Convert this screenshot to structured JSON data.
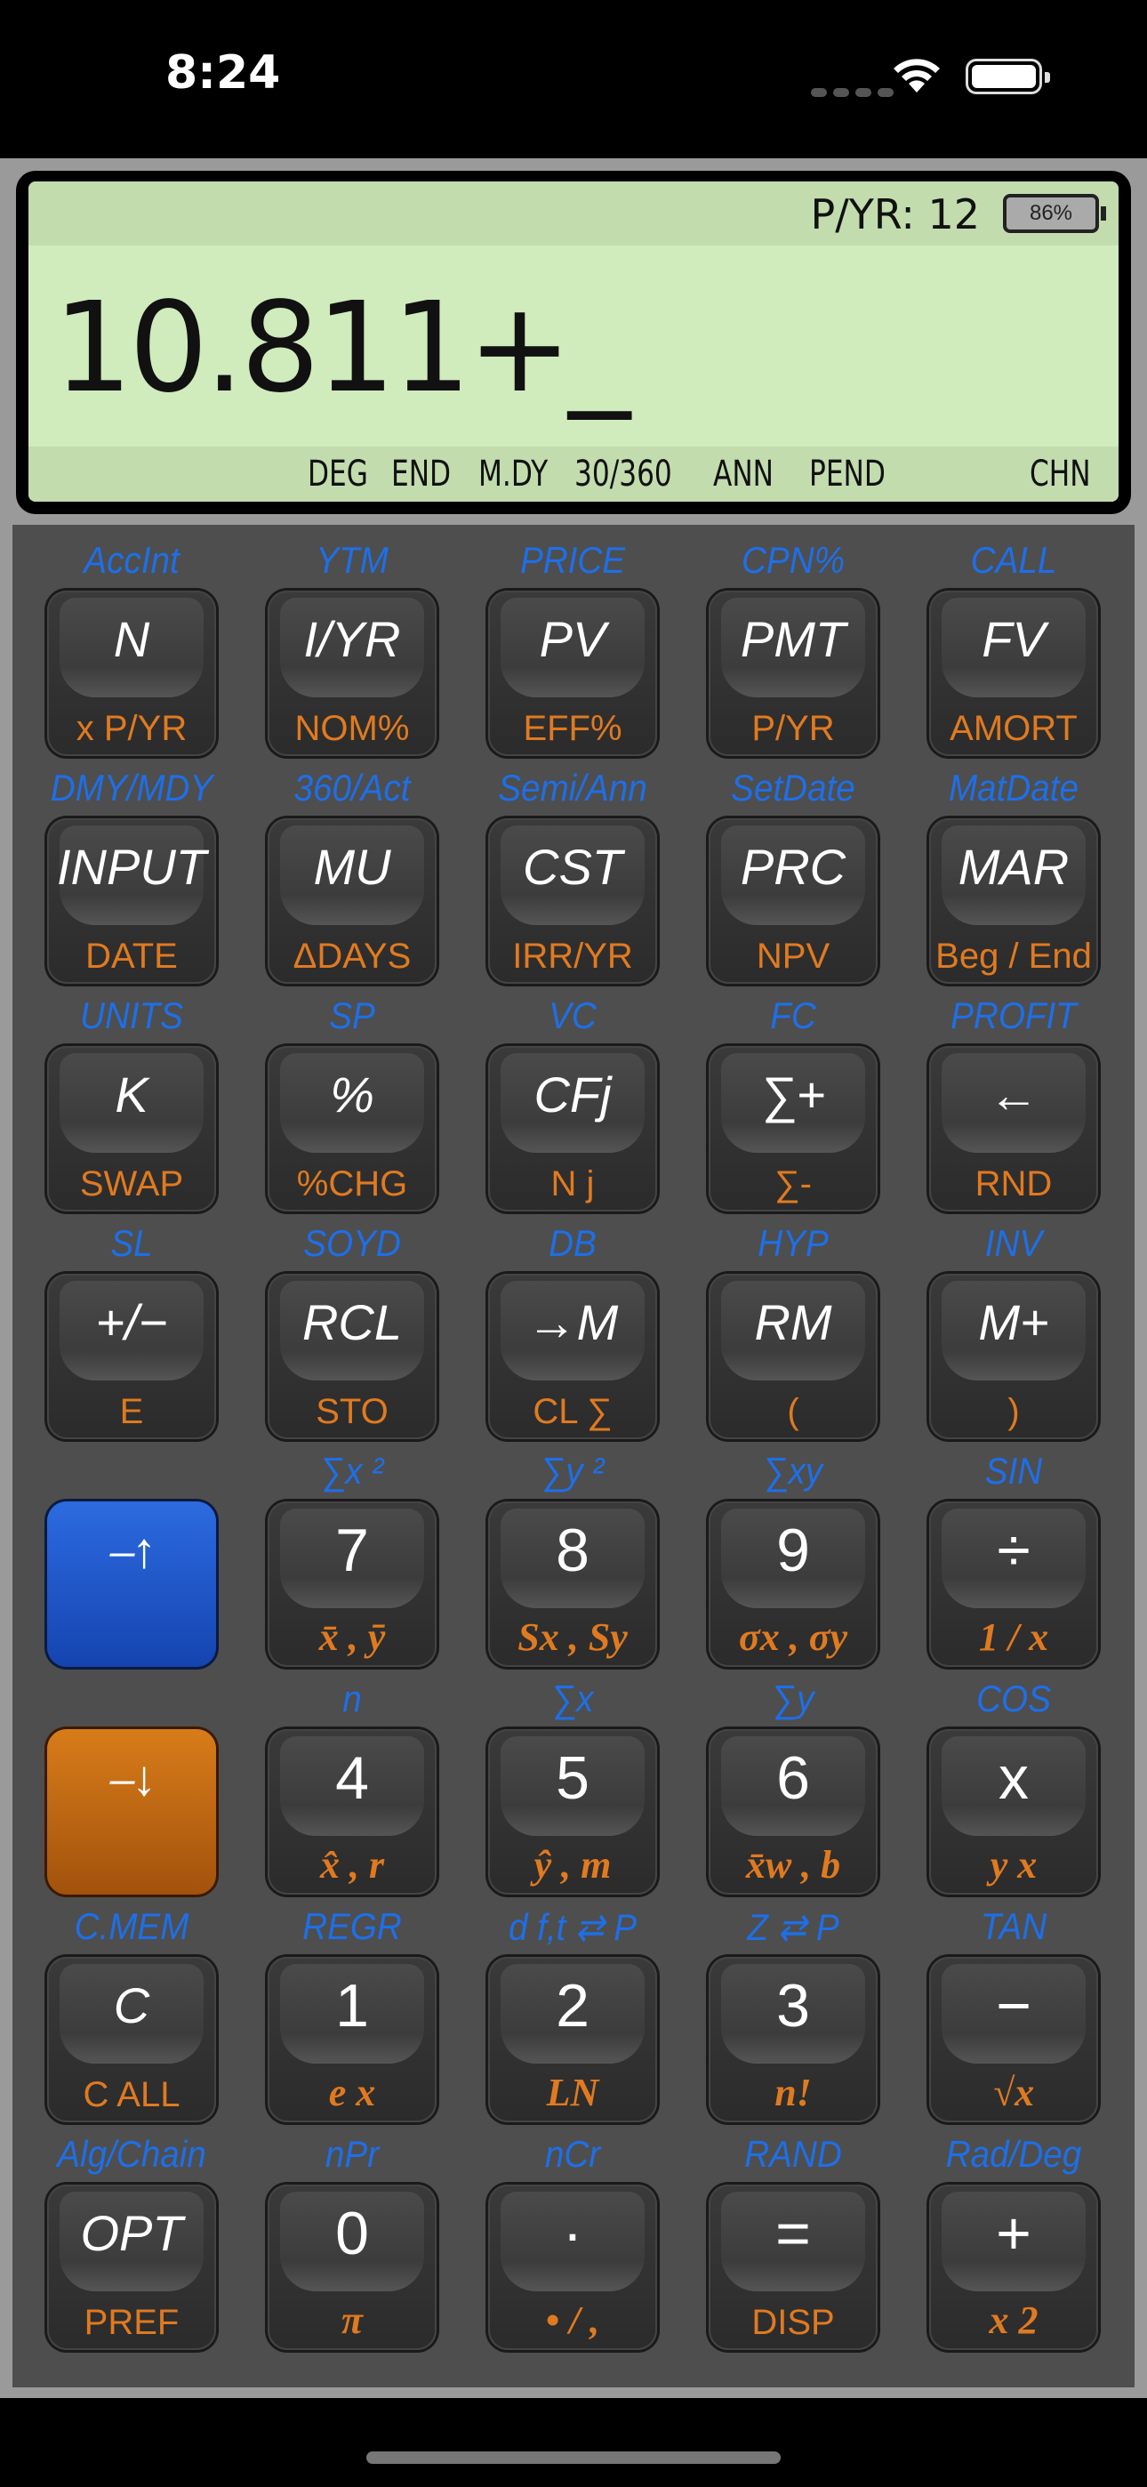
{
  "status_bar": {
    "time": "8:24"
  },
  "display": {
    "pyr": "P/YR: 12",
    "battery_pct": "86%",
    "readout": "10.811+_",
    "annunciators": [
      "DEG",
      "END",
      "M.DY",
      "30/360",
      "ANN",
      "PEND",
      "CHN"
    ]
  },
  "rows": [
    {
      "keys": [
        {
          "shift": "AccInt",
          "main": "N",
          "sub": "x P/YR"
        },
        {
          "shift": "YTM",
          "main": "I/YR",
          "sub": "NOM%"
        },
        {
          "shift": "PRICE",
          "main": "PV",
          "sub": "EFF%"
        },
        {
          "shift": "CPN%",
          "main": "PMT",
          "sub": "P/YR"
        },
        {
          "shift": "CALL",
          "main": "FV",
          "sub": "AMORT"
        }
      ]
    },
    {
      "keys": [
        {
          "shift": "DMY/MDY",
          "main": "INPUT",
          "sub": "DATE"
        },
        {
          "shift": "360/Act",
          "main": "MU",
          "sub": "ΔDAYS"
        },
        {
          "shift": "Semi/Ann",
          "main": "CST",
          "sub": "IRR/YR"
        },
        {
          "shift": "SetDate",
          "main": "PRC",
          "sub": "NPV"
        },
        {
          "shift": "MatDate",
          "main": "MAR",
          "sub": "Beg / End"
        }
      ]
    },
    {
      "keys": [
        {
          "shift": "UNITS",
          "main": "K",
          "sub": "SWAP"
        },
        {
          "shift": "SP",
          "main": "%",
          "sub": "%CHG"
        },
        {
          "shift": "VC",
          "main": "CFj",
          "sub": "N j"
        },
        {
          "shift": "FC",
          "main": "∑+",
          "sub": "∑-"
        },
        {
          "shift": "PROFIT",
          "main": "←",
          "sub": "RND"
        }
      ]
    },
    {
      "keys": [
        {
          "shift": "SL",
          "main": "+/−",
          "sub": "E"
        },
        {
          "shift": "SOYD",
          "main": "RCL",
          "sub": "STO"
        },
        {
          "shift": "DB",
          "main": "→M",
          "sub": "CL ∑"
        },
        {
          "shift": "HYP",
          "main": "RM",
          "sub": "("
        },
        {
          "shift": "INV",
          "main": "M+",
          "sub": ")"
        }
      ]
    },
    {
      "keys": [
        {
          "shift": "",
          "main": "⎯↑",
          "sub": ""
        },
        {
          "shift": "∑x ²",
          "main": "7",
          "sub": "x̄ , ȳ"
        },
        {
          "shift": "∑y ²",
          "main": "8",
          "sub": "Sx , Sy"
        },
        {
          "shift": "∑xy",
          "main": "9",
          "sub": "σx , σy"
        },
        {
          "shift": "SIN",
          "main": "÷",
          "sub": "1 / x"
        }
      ]
    },
    {
      "keys": [
        {
          "shift": "",
          "main": "⎯↓",
          "sub": ""
        },
        {
          "shift": "n",
          "main": "4",
          "sub": "x̂ , r"
        },
        {
          "shift": "∑x",
          "main": "5",
          "sub": "ŷ , m"
        },
        {
          "shift": "∑y",
          "main": "6",
          "sub": "x̄w , b"
        },
        {
          "shift": "COS",
          "main": "x",
          "sub": "y x"
        }
      ]
    },
    {
      "keys": [
        {
          "shift": "C.MEM",
          "main": "C",
          "sub": "C ALL"
        },
        {
          "shift": "REGR",
          "main": "1",
          "sub": "e x"
        },
        {
          "shift": "d f,t ⇄ P",
          "main": "2",
          "sub": "LN"
        },
        {
          "shift": "Z ⇄ P",
          "main": "3",
          "sub": "n!"
        },
        {
          "shift": "TAN",
          "main": "−",
          "sub": "√x"
        }
      ]
    },
    {
      "keys": [
        {
          "shift": "Alg/Chain",
          "main": "OPT",
          "sub": "PREF"
        },
        {
          "shift": "nPr",
          "main": "0",
          "sub": "π"
        },
        {
          "shift": "nCr",
          "main": "·",
          "sub": "• / ,"
        },
        {
          "shift": "RAND",
          "main": "=",
          "sub": "DISP"
        },
        {
          "shift": "Rad/Deg",
          "main": "+",
          "sub": "x 2"
        }
      ]
    }
  ]
}
